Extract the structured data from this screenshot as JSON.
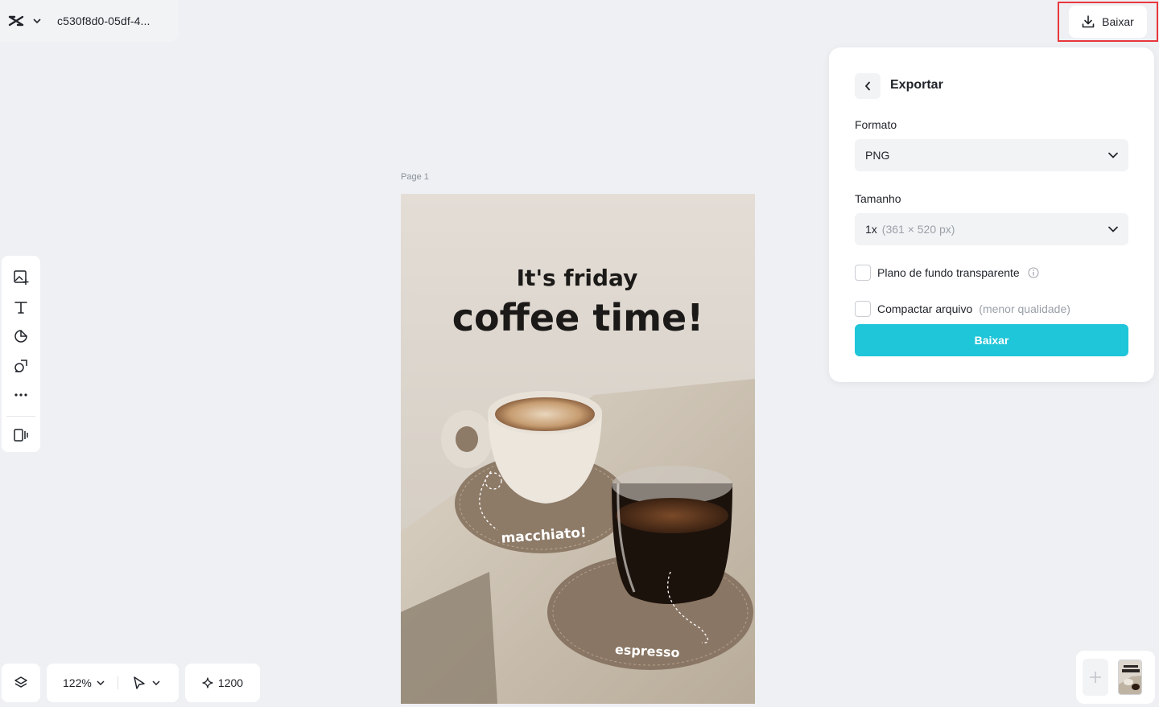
{
  "header": {
    "file_name": "c530f8d0-05df-4...",
    "download_label": "Baixar"
  },
  "export_panel": {
    "title": "Exportar",
    "format_label": "Formato",
    "format_value": "PNG",
    "size_label": "Tamanho",
    "size_value": "1x",
    "size_detail": "(361 × 520 px)",
    "transparent_bg_label": "Plano de fundo transparente",
    "compress_label": "Compactar arquivo",
    "compress_note": "(menor qualidade)",
    "download_button": "Baixar",
    "accent_color": "#1fc5d9"
  },
  "canvas": {
    "page_label": "Page 1",
    "poster": {
      "line1": "It's friday",
      "line2": "coffee time!",
      "label_macchiato": "macchiato!",
      "label_espresso": "espresso"
    }
  },
  "toolbar": {
    "items": [
      "add-image-icon",
      "text-icon",
      "sticker-icon",
      "shapes-icon",
      "more-icon",
      "template-icon"
    ]
  },
  "bottom": {
    "zoom": "122%",
    "credits": "1200"
  },
  "highlight_color": "#e8373d"
}
